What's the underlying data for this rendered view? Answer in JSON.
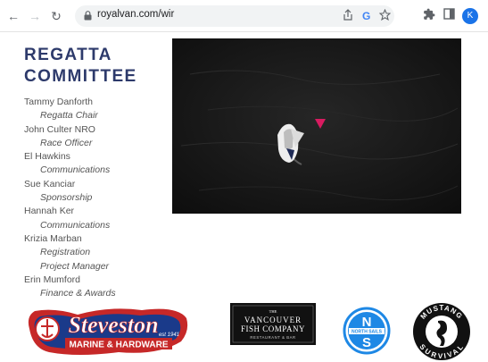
{
  "browser": {
    "url": "royalvan.com/wir",
    "google_icon": "G",
    "profile_initial": "K",
    "icons": [
      "back-arrow-icon",
      "forward-arrow-icon",
      "reload-icon",
      "lock-icon",
      "google-icon",
      "share-icon",
      "star-icon",
      "extensions-icon",
      "sidebar-icon",
      "profile-avatar"
    ]
  },
  "page": {
    "heading_line1": "REGATTA",
    "heading_line2": "COMMITTEE",
    "members": [
      {
        "name": "Tammy Danforth",
        "roles": [
          "Regatta Chair"
        ]
      },
      {
        "name": "John Culter NRO",
        "roles": [
          "Race Officer"
        ]
      },
      {
        "name": "El Hawkins",
        "roles": [
          "Communications"
        ]
      },
      {
        "name": "Sue Kanciar",
        "roles": [
          "Sponsorship"
        ]
      },
      {
        "name": "Hannah Ker",
        "roles": [
          "Communications"
        ]
      },
      {
        "name": "Krizia Marban",
        "roles": [
          "Registration",
          "Project Manager"
        ]
      },
      {
        "name": "Erin Mumford",
        "roles": [
          "Finance & Awards"
        ]
      }
    ]
  },
  "sponsors": {
    "steveston": {
      "line1": "Steveston",
      "line2": "MARINE & HARDWARE",
      "est": "est 1941"
    },
    "vancouver_fish": {
      "line0": "THE",
      "line1": "VANCOUVER",
      "line2": "FISH COMPANY",
      "line3": "RESTAURANT & BAR"
    },
    "north_sails": {
      "top": "N",
      "mid": "NORTH SAILS",
      "bottom": "S"
    },
    "mustang": {
      "top": "MUSTANG",
      "bottom": "SURVIVAL"
    }
  },
  "colors": {
    "heading": "#2d3a6b",
    "accent_blue": "#1a73e8",
    "water": "#141414",
    "buoy": "#d81b60"
  }
}
